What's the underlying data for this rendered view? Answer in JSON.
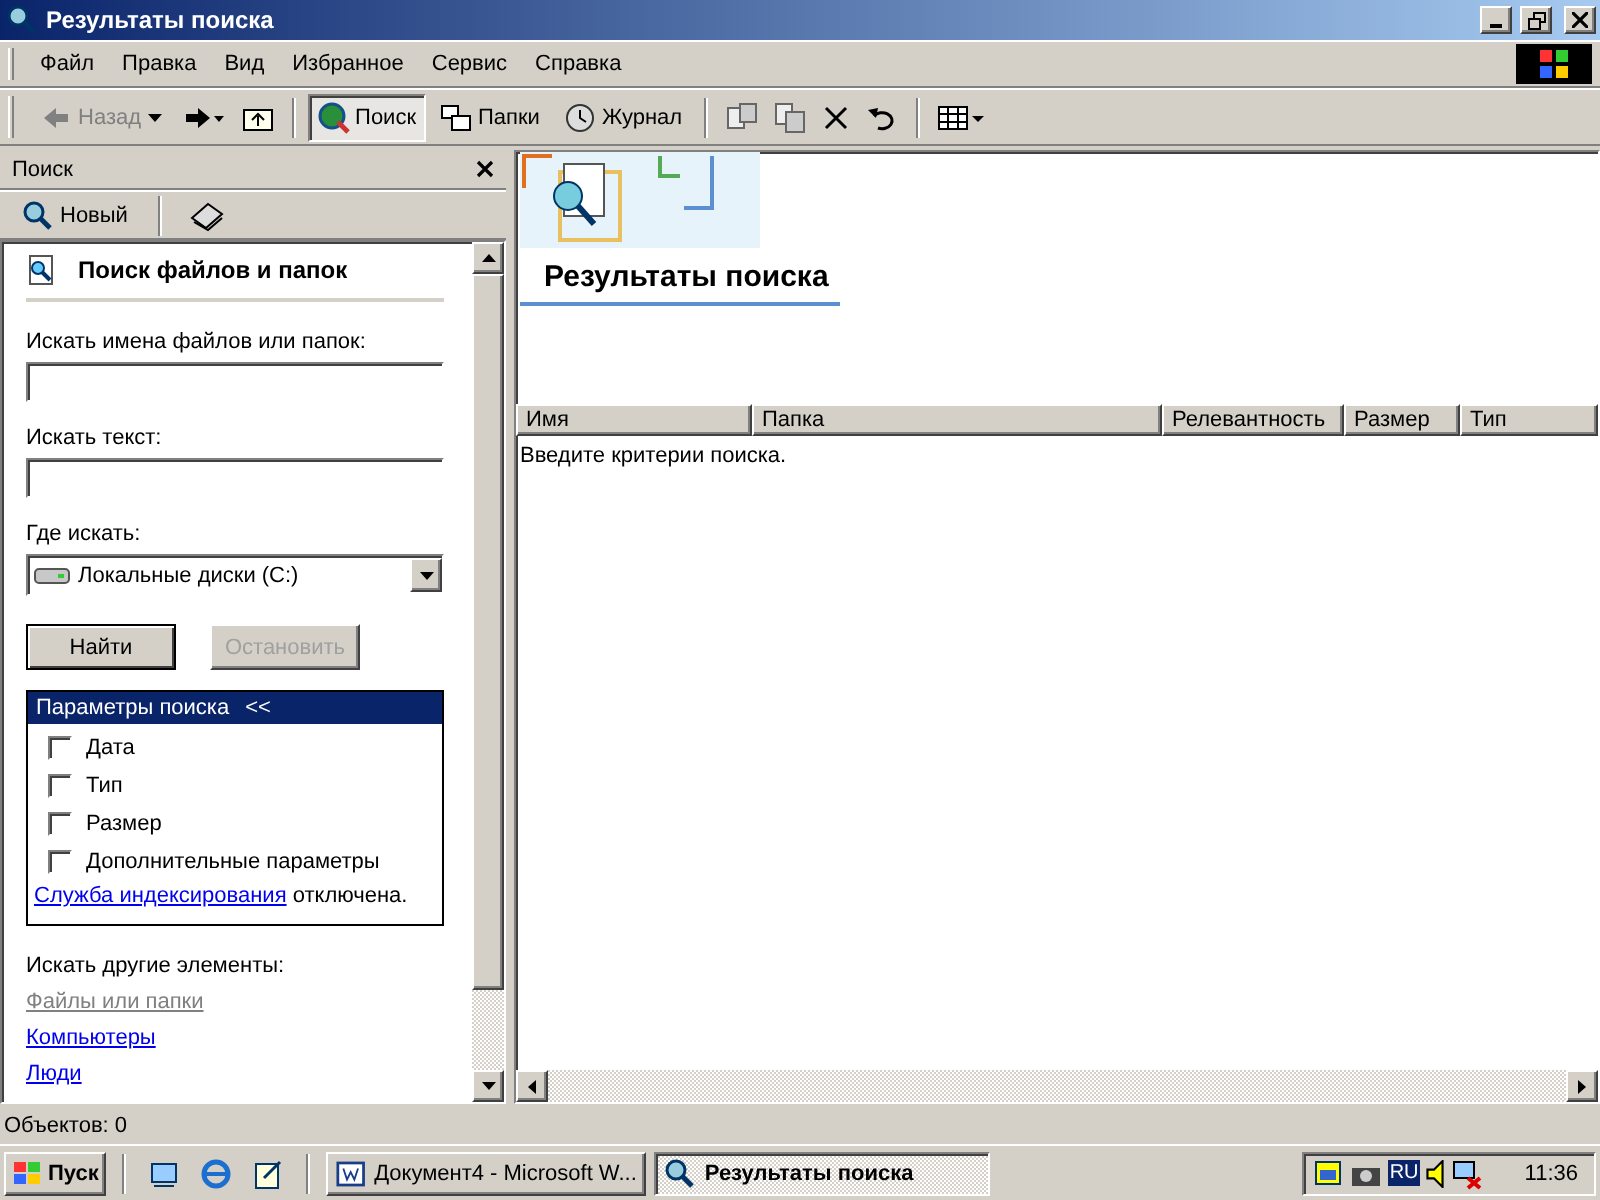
{
  "window": {
    "title": "Результаты поиска"
  },
  "menu": [
    {
      "label": "Файл"
    },
    {
      "label": "Правка"
    },
    {
      "label": "Вид"
    },
    {
      "label": "Избранное"
    },
    {
      "label": "Сервис"
    },
    {
      "label": "Справка"
    }
  ],
  "toolbar": [
    {
      "kind": "back",
      "label": "Назад",
      "disabled": true,
      "selected": false
    },
    {
      "kind": "search",
      "label": "Поиск",
      "disabled": false,
      "selected": true
    },
    {
      "kind": "folders",
      "label": "Папки",
      "disabled": false,
      "selected": false
    },
    {
      "kind": "history",
      "label": "Журнал",
      "disabled": false,
      "selected": false
    }
  ],
  "search_pane": {
    "title": "Поиск",
    "new_button": "Новый",
    "heading": "Поиск файлов и папок",
    "fields": [
      {
        "label": "Искать имена файлов или папок:"
      },
      {
        "label": "Искать текст:"
      }
    ],
    "location": {
      "label": "Где искать:",
      "value": "Локальные диски (C:)"
    },
    "buttons": [
      {
        "label": "Найти",
        "disabled": false
      },
      {
        "label": "Остановить",
        "disabled": true
      }
    ],
    "options": {
      "title": "Параметры поиска",
      "toggle": "<<",
      "expanded": true,
      "checkboxes": [
        {
          "label": "Дата",
          "checked": false
        },
        {
          "label": "Тип",
          "checked": false
        },
        {
          "label": "Размер",
          "checked": false
        },
        {
          "label": "Дополнительные параметры",
          "checked": false
        }
      ],
      "indexing_link": "Служба индексирования",
      "indexing_text": "отключена."
    },
    "other_label": "Искать другие элементы:",
    "other_links": [
      {
        "label": "Файлы или папки",
        "disabled": true
      },
      {
        "label": "Компьютеры",
        "disabled": false
      },
      {
        "label": "Люди",
        "disabled": false
      }
    ]
  },
  "results": {
    "heading": "Результаты поиска",
    "columns": [
      {
        "label": "Имя"
      },
      {
        "label": "Папка"
      },
      {
        "label": "Релевантность"
      },
      {
        "label": "Размер"
      },
      {
        "label": "Тип"
      }
    ],
    "message": "Введите критерии поиска."
  },
  "status_bar": {
    "text": "Объектов: 0"
  },
  "taskbar": {
    "start": "Пуск",
    "tasks": [
      {
        "label": "Документ4 - Microsoft W...",
        "selected": false
      },
      {
        "label": "Результаты поиска",
        "selected": true
      }
    ],
    "language": "RU",
    "clock": "11:36"
  }
}
